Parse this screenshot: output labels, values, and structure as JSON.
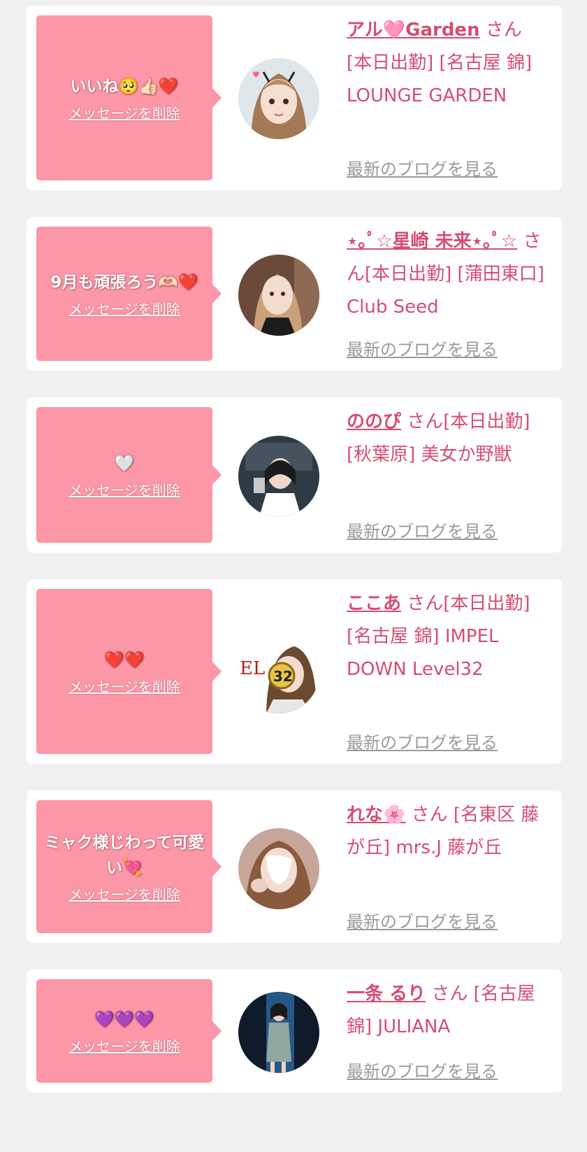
{
  "cards": [
    {
      "message": "いいね🥺👍🏻❤️",
      "delete_label": "メッセージを削除",
      "name": "アル🩷Garden",
      "detail": "さん [本日出勤] [名古屋 錦] LOUNGE GARDEN",
      "blog_label": "最新のブログを見る"
    },
    {
      "message": "9月も頑張ろう🫶🏻❤️",
      "delete_label": "メッセージを削除",
      "name": "⋆｡ﾟ☆星崎 未来⋆｡ﾟ☆",
      "detail": "さん[本日出勤] [蒲田東口] Club Seed",
      "blog_label": "最新のブログを見る"
    },
    {
      "message": "🤍",
      "delete_label": "メッセージを削除",
      "name": "ののぴ",
      "detail": "さん[本日出勤] [秋葉原] 美女か野獣",
      "blog_label": "最新のブログを見る"
    },
    {
      "message": "❤️❤️",
      "delete_label": "メッセージを削除",
      "name": "ここあ",
      "detail": "さん[本日出勤] [名古屋 錦] IMPEL DOWN Level32",
      "blog_label": "最新のブログを見る"
    },
    {
      "message": "ミャク様じわって可愛い💘",
      "delete_label": "メッセージを削除",
      "name": "れな🌸",
      "detail": "さん [名東区 藤が丘] mrs.J 藤が丘",
      "blog_label": "最新のブログを見る"
    },
    {
      "message": "💜💜💜",
      "delete_label": "メッセージを削除",
      "name": "一条 るり",
      "detail": "さん [名古屋 錦] JULIANA",
      "blog_label": "最新のブログを見る"
    }
  ],
  "colors": {
    "bubble": "#fc97a7",
    "name": "#d64d72",
    "blog_link": "#9a9a9a",
    "page_bg": "#f1f1f1"
  }
}
